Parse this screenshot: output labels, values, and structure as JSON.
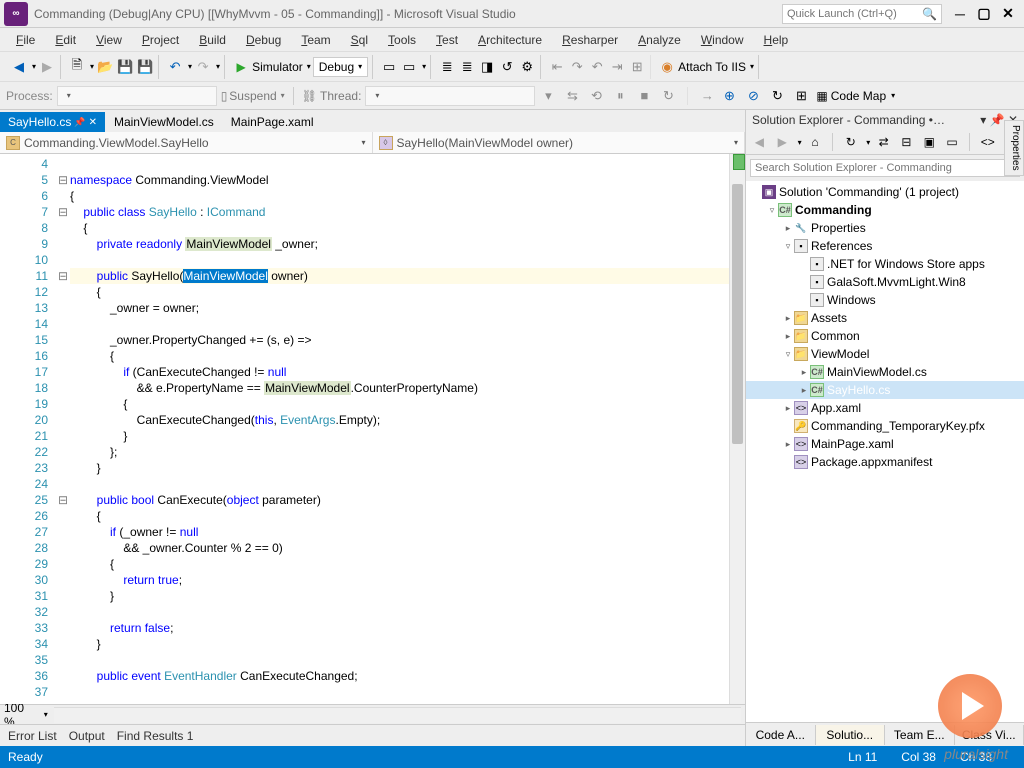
{
  "title": "Commanding (Debug|Any CPU) [[WhyMvvm - 05 - Commanding]] - Microsoft Visual Studio",
  "quickLaunch": {
    "placeholder": "Quick Launch (Ctrl+Q)"
  },
  "menu": [
    "File",
    "Edit",
    "View",
    "Project",
    "Build",
    "Debug",
    "Team",
    "Sql",
    "Tools",
    "Test",
    "Architecture",
    "Resharper",
    "Analyze",
    "Window",
    "Help"
  ],
  "toolbar": {
    "simulatorLabel": "Simulator",
    "configLabel": "Debug",
    "attachLabel": "Attach To IIS"
  },
  "toolbar2": {
    "processLabel": "Process:",
    "suspendLabel": "Suspend",
    "threadLabel": "Thread:",
    "codeMapLabel": "Code Map"
  },
  "docTabs": [
    {
      "label": "SayHello.cs",
      "active": true,
      "pinned": true
    },
    {
      "label": "MainViewModel.cs",
      "active": false
    },
    {
      "label": "MainPage.xaml",
      "active": false
    }
  ],
  "breadcrumb": {
    "left": "Commanding.ViewModel.SayHello",
    "right": "SayHello(MainViewModel owner)"
  },
  "lineStart": 4,
  "lineEnd": 37,
  "code": [
    {
      "n": 4,
      "t": ""
    },
    {
      "n": 5,
      "fold": "-",
      "t_html": "<span class='kw'>namespace</span> Commanding.ViewModel"
    },
    {
      "n": 6,
      "t": "{"
    },
    {
      "n": 7,
      "fold": "-",
      "t_html": "    <span class='kw'>public</span> <span class='kw'>class</span> <span class='tp'>SayHello</span> : <span class='tp'>ICommand</span>"
    },
    {
      "n": 8,
      "t": "    {"
    },
    {
      "n": 9,
      "t_html": "        <span class='kw'>private</span> <span class='kw'>readonly</span> <span class='hl-bg'>MainViewModel</span> _owner;"
    },
    {
      "n": 10,
      "t": ""
    },
    {
      "n": 11,
      "fold": "-",
      "cls": "cur-line",
      "t_html": "        <span class='kw'>public</span> SayHello(<span class='sel'>MainViewModel</span> owner)"
    },
    {
      "n": 12,
      "t": "        {"
    },
    {
      "n": 13,
      "t": "            _owner = owner;"
    },
    {
      "n": 14,
      "t": ""
    },
    {
      "n": 15,
      "t": "            _owner.PropertyChanged += (s, e) =>"
    },
    {
      "n": 16,
      "t": "            {"
    },
    {
      "n": 17,
      "t_html": "                <span class='kw'>if</span> (CanExecuteChanged != <span class='kw'>null</span>"
    },
    {
      "n": 18,
      "t_html": "                    && e.PropertyName == <span class='hl-bg'>MainViewModel</span>.CounterPropertyName)"
    },
    {
      "n": 19,
      "t": "                {"
    },
    {
      "n": 20,
      "t_html": "                    CanExecuteChanged(<span class='kw'>this</span>, <span class='tp'>EventArgs</span>.Empty);"
    },
    {
      "n": 21,
      "t": "                }"
    },
    {
      "n": 22,
      "t": "            };"
    },
    {
      "n": 23,
      "t": "        }"
    },
    {
      "n": 24,
      "t": ""
    },
    {
      "n": 25,
      "fold": "-",
      "t_html": "        <span class='kw'>public</span> <span class='kw'>bool</span> CanExecute(<span class='kw'>object</span> parameter)"
    },
    {
      "n": 26,
      "t": "        {"
    },
    {
      "n": 27,
      "t_html": "            <span class='kw'>if</span> (_owner != <span class='kw'>null</span>"
    },
    {
      "n": 28,
      "t": "                && _owner.Counter % 2 == 0)"
    },
    {
      "n": 29,
      "t": "            {"
    },
    {
      "n": 30,
      "t_html": "                <span class='kw'>return</span> <span class='kw'>true</span>;"
    },
    {
      "n": 31,
      "t": "            }"
    },
    {
      "n": 32,
      "t": ""
    },
    {
      "n": 33,
      "t_html": "            <span class='kw'>return</span> <span class='kw'>false</span>;"
    },
    {
      "n": 34,
      "t": "        }"
    },
    {
      "n": 35,
      "t": ""
    },
    {
      "n": 36,
      "t_html": "        <span class='kw'>public</span> <span class='kw'>event</span> <span class='tp'>EventHandler</span> CanExecuteChanged;"
    },
    {
      "n": 37,
      "t": ""
    }
  ],
  "zoom": "100 %",
  "outputTabs": [
    "Error List",
    "Output",
    "Find Results 1"
  ],
  "status": {
    "ready": "Ready",
    "ln": "Ln 11",
    "col": "Col 38",
    "ch": "Ch 38"
  },
  "solutionExplorer": {
    "title": "Solution Explorer - Commanding •…",
    "searchPlaceholder": "Search Solution Explorer - Commanding",
    "tree": [
      {
        "d": 0,
        "exp": "",
        "ico": "sol",
        "label": "Solution 'Commanding' (1 project)"
      },
      {
        "d": 1,
        "exp": "▿",
        "ico": "proj",
        "label": "Commanding",
        "bold": true
      },
      {
        "d": 2,
        "exp": "▸",
        "ico": "wrench",
        "label": "Properties"
      },
      {
        "d": 2,
        "exp": "▿",
        "ico": "ref",
        "label": "References"
      },
      {
        "d": 3,
        "exp": "",
        "ico": "ref",
        "label": ".NET for Windows Store apps"
      },
      {
        "d": 3,
        "exp": "",
        "ico": "ref",
        "label": "GalaSoft.MvvmLight.Win8"
      },
      {
        "d": 3,
        "exp": "",
        "ico": "ref",
        "label": "Windows"
      },
      {
        "d": 2,
        "exp": "▸",
        "ico": "fold",
        "label": "Assets"
      },
      {
        "d": 2,
        "exp": "▸",
        "ico": "fold",
        "label": "Common"
      },
      {
        "d": 2,
        "exp": "▿",
        "ico": "fold",
        "label": "ViewModel"
      },
      {
        "d": 3,
        "exp": "▸",
        "ico": "cs",
        "label": "MainViewModel.cs"
      },
      {
        "d": 3,
        "exp": "▸",
        "ico": "cs",
        "label": "SayHello.cs",
        "sel": true
      },
      {
        "d": 2,
        "exp": "▸",
        "ico": "xaml",
        "label": "App.xaml"
      },
      {
        "d": 2,
        "exp": "",
        "ico": "key",
        "label": "Commanding_TemporaryKey.pfx"
      },
      {
        "d": 2,
        "exp": "▸",
        "ico": "xaml",
        "label": "MainPage.xaml"
      },
      {
        "d": 2,
        "exp": "",
        "ico": "xaml",
        "label": "Package.appxmanifest"
      }
    ],
    "bottomTabs": [
      "Code A...",
      "Solutio...",
      "Team E...",
      "Class Vi..."
    ]
  },
  "vtab": "Properties",
  "pluralsight": "pluralsight"
}
